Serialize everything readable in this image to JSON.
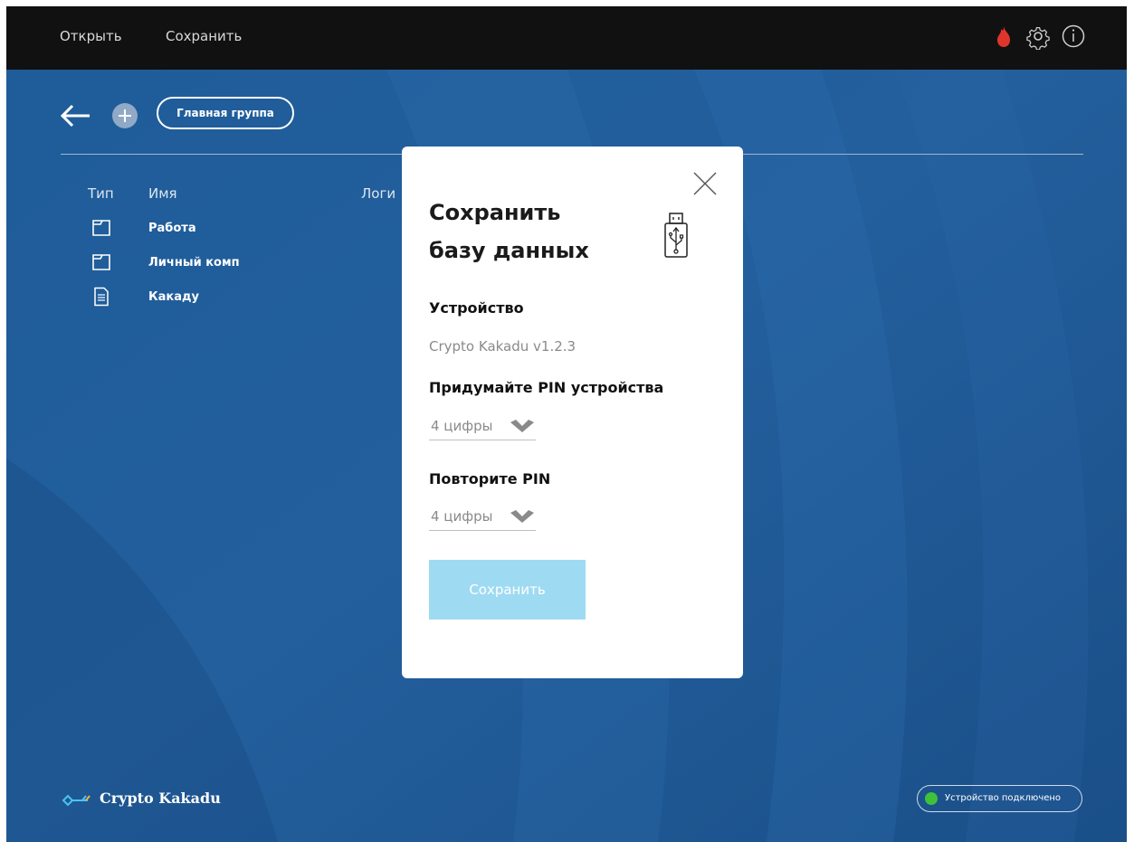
{
  "menubar": {
    "open_label": "Открыть",
    "save_label": "Сохранить"
  },
  "toolbar": {
    "group_label": "Главная группа"
  },
  "table": {
    "headers": [
      "Тип",
      "Имя",
      "Логи"
    ],
    "rows": [
      {
        "type": "folder-icon",
        "name": "Работа"
      },
      {
        "type": "folder-icon",
        "name": "Личный комп"
      },
      {
        "type": "document-icon",
        "name": "Какаду"
      }
    ]
  },
  "footer": {
    "logo_text": "Crypto Kakadu",
    "status_text": "Устройство подключено",
    "status_color": "#3fc23a"
  },
  "dialog": {
    "title_line1": "Сохранить",
    "title_line2": "базу данных",
    "device_label": "Устройство",
    "device_value": "Crypto Kakadu v1.2.3",
    "pin_label": "Придумайте PIN устройства",
    "pin_placeholder": "4 цифры",
    "repeat_label": "Повторите PIN",
    "repeat_placeholder": "4 цифры",
    "save_button": "Сохранить"
  },
  "colors": {
    "background": "#1f5a95",
    "menubar": "#111111",
    "flame": "#e0352b",
    "save_button": "#9fdaf3"
  }
}
